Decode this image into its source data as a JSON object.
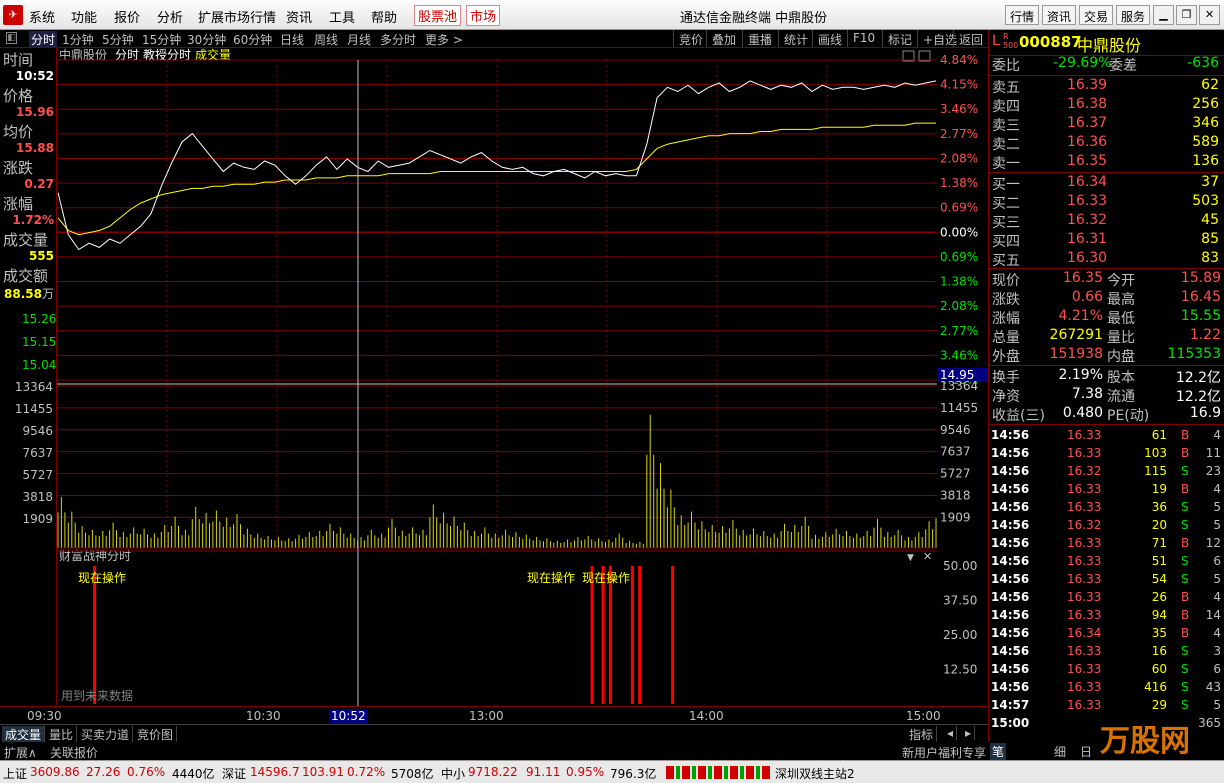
{
  "menu": {
    "items": [
      "系统",
      "功能",
      "报价",
      "分析",
      "扩展市场行情",
      "资讯",
      "工具",
      "帮助"
    ],
    "highlight": [
      "股票池",
      "市场"
    ],
    "title": "通达信金融终端  中鼎股份",
    "right_buttons": [
      "行情",
      "资讯",
      "交易",
      "服务"
    ]
  },
  "period": {
    "tabs": [
      "分时",
      "1分钟",
      "5分钟",
      "15分钟",
      "30分钟",
      "60分钟",
      "日线",
      "周线",
      "月线",
      "多分时",
      "更多 >"
    ],
    "tools": [
      "竞价",
      "叠加",
      "重播",
      "统计",
      "画线",
      "F10",
      "标记",
      "+自选",
      "返回"
    ]
  },
  "chart_header": {
    "name": "中鼎股份",
    "mode": "分时",
    "indicator": "教授分时",
    "volume": "成交量"
  },
  "leftinfo": {
    "time_label": "时间",
    "time": "10:52",
    "price_label": "价格",
    "price": "15.96",
    "avg_label": "均价",
    "avg": "15.88",
    "chg_label": "涨跌",
    "chg": "0.27",
    "pct_label": "涨幅",
    "pct": "1.72%",
    "vol_label": "成交量",
    "vol": "555",
    "amt_label": "成交额",
    "amt": "88.58",
    "amt_unit": "万"
  },
  "left_price_ticks": [
    "15.26",
    "15.15",
    "15.04"
  ],
  "pct_ticks": [
    "4.84%",
    "4.15%",
    "3.46%",
    "2.77%",
    "2.08%",
    "1.38%",
    "0.69%",
    "0.00%",
    "0.69%",
    "1.38%",
    "2.08%",
    "2.77%",
    "3.46%",
    "4.15%"
  ],
  "cursor_price": "14.95",
  "vol_ticks": [
    "13364",
    "11455",
    "9546",
    "7637",
    "5727",
    "3818",
    "1909"
  ],
  "sub_ticks": [
    "50.00",
    "37.50",
    "25.00",
    "12.50"
  ],
  "sub": {
    "title": "财富战神分时",
    "signal": "现在操作",
    "note": "用到未来数据"
  },
  "time_axis": {
    "labels": [
      "09:30",
      "10:30",
      "13:00",
      "14:00",
      "15:00"
    ],
    "cursor": "10:52"
  },
  "bottom_tabs": [
    "成交量",
    "量比",
    "买卖力道",
    "竞价图"
  ],
  "bottom_right": "指标",
  "ext": {
    "left": [
      "扩展∧",
      "关联报价"
    ],
    "right": "新用户福利专享"
  },
  "stock": {
    "flag": "L",
    "sub": "R 500",
    "code": "000887",
    "name": "中鼎股份"
  },
  "weibi": {
    "label": "委比",
    "value": "-29.69%",
    "diff_label": "委差",
    "diff": "-636"
  },
  "asks": [
    {
      "l": "卖五",
      "p": "16.39",
      "v": "62"
    },
    {
      "l": "卖四",
      "p": "16.38",
      "v": "256"
    },
    {
      "l": "卖三",
      "p": "16.37",
      "v": "346"
    },
    {
      "l": "卖二",
      "p": "16.36",
      "v": "589"
    },
    {
      "l": "卖一",
      "p": "16.35",
      "v": "136"
    }
  ],
  "bids": [
    {
      "l": "买一",
      "p": "16.34",
      "v": "37"
    },
    {
      "l": "买二",
      "p": "16.33",
      "v": "503"
    },
    {
      "l": "买三",
      "p": "16.32",
      "v": "45"
    },
    {
      "l": "买四",
      "p": "16.31",
      "v": "85"
    },
    {
      "l": "买五",
      "p": "16.30",
      "v": "83"
    }
  ],
  "quote": [
    {
      "l1": "现价",
      "v1": "16.35",
      "c1": "red",
      "l2": "今开",
      "v2": "15.89",
      "c2": "red"
    },
    {
      "l1": "涨跌",
      "v1": "0.66",
      "c1": "red",
      "l2": "最高",
      "v2": "16.45",
      "c2": "red"
    },
    {
      "l1": "涨幅",
      "v1": "4.21%",
      "c1": "red",
      "l2": "最低",
      "v2": "15.55",
      "c2": "green"
    },
    {
      "l1": "总量",
      "v1": "267291",
      "c1": "yellow",
      "l2": "量比",
      "v2": "1.22",
      "c2": "red"
    },
    {
      "l1": "外盘",
      "v1": "151938",
      "c1": "red",
      "l2": "内盘",
      "v2": "115353",
      "c2": "green"
    }
  ],
  "fund": [
    {
      "l1": "换手",
      "v1": "2.19%",
      "l2": "股本",
      "v2": "12.2亿"
    },
    {
      "l1": "净资",
      "v1": "7.38",
      "l2": "流通",
      "v2": "12.2亿"
    },
    {
      "l1": "收益(三)",
      "v1": "0.480",
      "l2": "PE(动)",
      "v2": "16.9"
    }
  ],
  "ticks": [
    {
      "t": "14:56",
      "p": "16.33",
      "pc": "red",
      "v": "61",
      "vc": "yellow",
      "s": "B",
      "n": "4"
    },
    {
      "t": "14:56",
      "p": "16.33",
      "pc": "red",
      "v": "103",
      "vc": "yellow",
      "s": "B",
      "n": "11"
    },
    {
      "t": "14:56",
      "p": "16.32",
      "pc": "red",
      "v": "115",
      "vc": "yellow",
      "s": "S",
      "n": "23"
    },
    {
      "t": "14:56",
      "p": "16.33",
      "pc": "red",
      "v": "19",
      "vc": "yellow",
      "s": "B",
      "n": "4"
    },
    {
      "t": "14:56",
      "p": "16.33",
      "pc": "red",
      "v": "36",
      "vc": "yellow",
      "s": "S",
      "n": "5"
    },
    {
      "t": "14:56",
      "p": "16.32",
      "pc": "red",
      "v": "20",
      "vc": "yellow",
      "s": "S",
      "n": "5"
    },
    {
      "t": "14:56",
      "p": "16.33",
      "pc": "red",
      "v": "71",
      "vc": "yellow",
      "s": "B",
      "n": "12"
    },
    {
      "t": "14:56",
      "p": "16.33",
      "pc": "red",
      "v": "51",
      "vc": "yellow",
      "s": "S",
      "n": "6"
    },
    {
      "t": "14:56",
      "p": "16.33",
      "pc": "red",
      "v": "54",
      "vc": "yellow",
      "s": "S",
      "n": "5"
    },
    {
      "t": "14:56",
      "p": "16.33",
      "pc": "red",
      "v": "26",
      "vc": "yellow",
      "s": "B",
      "n": "4"
    },
    {
      "t": "14:56",
      "p": "16.33",
      "pc": "red",
      "v": "94",
      "vc": "yellow",
      "s": "B",
      "n": "14"
    },
    {
      "t": "14:56",
      "p": "16.34",
      "pc": "red",
      "v": "35",
      "vc": "yellow",
      "s": "B",
      "n": "4"
    },
    {
      "t": "14:56",
      "p": "16.33",
      "pc": "red",
      "v": "16",
      "vc": "yellow",
      "s": "S",
      "n": "3"
    },
    {
      "t": "14:56",
      "p": "16.33",
      "pc": "red",
      "v": "60",
      "vc": "yellow",
      "s": "S",
      "n": "6"
    },
    {
      "t": "14:56",
      "p": "16.33",
      "pc": "red",
      "v": "416",
      "vc": "yellow",
      "s": "S",
      "n": "43"
    },
    {
      "t": "14:57",
      "p": "16.33",
      "pc": "red",
      "v": "29",
      "vc": "yellow",
      "s": "S",
      "n": "5"
    },
    {
      "t": "15:00",
      "p": "",
      "pc": "red",
      "v": "",
      "vc": "yellow",
      "s": "",
      "n": "365"
    }
  ],
  "rp_tabs": [
    "笔",
    "细",
    "日"
  ],
  "status": {
    "sh_label": "上证",
    "sh": "3609.86",
    "sh_chg": "27.26",
    "sh_pct": "0.76%",
    "sh_amt": "4440亿",
    "sz_label": "深证",
    "sz": "14596.7",
    "sz_chg": "103.91",
    "sz_pct": "0.72%",
    "sz_amt": "5708亿",
    "zx_label": "中小",
    "zx": "9718.22",
    "zx_chg": "91.11",
    "zx_pct": "0.95%",
    "zx_amt": "796.3亿",
    "server": "深圳双线主站2",
    "logo": "万股网"
  },
  "chart_data": {
    "type": "line",
    "title": "中鼎股份 分时",
    "prev_close": 15.69,
    "price_series": {
      "name": "价格",
      "values": [
        15.82,
        15.62,
        15.55,
        15.58,
        15.56,
        15.6,
        15.58,
        15.62,
        15.66,
        15.72,
        15.85,
        15.96,
        16.06,
        16.1,
        16.04,
        15.98,
        15.92,
        15.96,
        15.94,
        15.93,
        15.97,
        15.95,
        15.9,
        15.86,
        15.9,
        15.95,
        15.99,
        15.93,
        15.98,
        15.94,
        15.92,
        15.97,
        15.94,
        15.95,
        15.96,
        15.99,
        16.02,
        16.0,
        15.98,
        15.96,
        15.99,
        16.01,
        15.97,
        15.94,
        15.93,
        15.94,
        15.91,
        15.9,
        15.92,
        15.93,
        15.91,
        15.89,
        15.92,
        15.9,
        15.91,
        15.9,
        15.9,
        16.05,
        16.27,
        16.32,
        16.3,
        16.33,
        16.29,
        16.32,
        16.34,
        16.3,
        16.32,
        16.35,
        16.33,
        16.31,
        16.33,
        16.32,
        16.34,
        16.3,
        16.33,
        16.31,
        16.32,
        16.32,
        16.31,
        16.32,
        16.33,
        16.32,
        16.34,
        16.33,
        16.34,
        16.35
      ]
    },
    "avg_series": {
      "name": "均价",
      "values": [
        15.7,
        15.64,
        15.62,
        15.63,
        15.64,
        15.66,
        15.7,
        15.74,
        15.77,
        15.79,
        15.81,
        15.82,
        15.83,
        15.84,
        15.84,
        15.85,
        15.85,
        15.86,
        15.86,
        15.86,
        15.87,
        15.87,
        15.88,
        15.88,
        15.88,
        15.89,
        15.89,
        15.89,
        15.9,
        15.9,
        15.9,
        15.9,
        15.91,
        15.91,
        15.91,
        15.91,
        15.91,
        15.92,
        15.92,
        15.92,
        15.92,
        15.92,
        15.92,
        15.92,
        15.92,
        15.92,
        15.92,
        15.92,
        15.92,
        15.92,
        15.92,
        15.92,
        15.92,
        15.92,
        15.92,
        15.92,
        15.93,
        15.98,
        16.03,
        16.05,
        16.06,
        16.07,
        16.08,
        16.09,
        16.09,
        16.1,
        16.1,
        16.1,
        16.11,
        16.11,
        16.12,
        16.12,
        16.12,
        16.12,
        16.13,
        16.13,
        16.13,
        16.13,
        16.13,
        16.14,
        16.14,
        16.14,
        16.14,
        16.15,
        16.15,
        16.15
      ]
    },
    "volume": [
      4200,
      3000,
      1800,
      1500,
      1400,
      2100,
      1300,
      1700,
      1600,
      1200,
      1900,
      2600,
      1500,
      3400,
      2900,
      3100,
      2500,
      2800,
      1600,
      1200,
      1000,
      900,
      800,
      1100,
      1300,
      1400,
      2000,
      1700,
      1200,
      900,
      1500,
      1200,
      2400,
      1400,
      1700,
      1500,
      3600,
      2900,
      2600,
      2100,
      1400,
      1700,
      1200,
      1500,
      1300,
      1100,
      900,
      800,
      600,
      700,
      900,
      1000,
      800,
      700,
      1200,
      600,
      500,
      11000,
      7000,
      4800,
      2700,
      3000,
      2200,
      1900,
      1800,
      2300,
      1500,
      1600,
      1400,
      1200,
      2000,
      1900,
      2600,
      1100,
      1300,
      1600,
      1400,
      1200,
      1400,
      2400,
      1300,
      1500,
      900,
      1300,
      2200,
      3500
    ],
    "volume_ylim": [
      0,
      13364
    ],
    "pct_range": [
      -4.84,
      4.84
    ],
    "signals": [
      {
        "time": "09:40",
        "value": 50
      },
      {
        "time": "13:26",
        "value": 50
      },
      {
        "time": "13:29",
        "value": 50
      },
      {
        "time": "13:31",
        "value": 50
      },
      {
        "time": "13:37",
        "value": 50
      },
      {
        "time": "13:39",
        "value": 50
      },
      {
        "time": "13:48",
        "value": 50
      }
    ],
    "sub_ylim": [
      0,
      50
    ],
    "cursor_time": "10:52"
  }
}
